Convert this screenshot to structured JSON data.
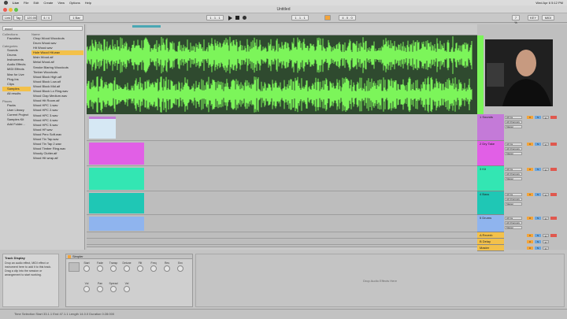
{
  "menubar": {
    "app": "Live",
    "items": [
      "File",
      "Edit",
      "Create",
      "View",
      "Options",
      "Help"
    ],
    "clock": "Wed Apr 6  5:12 PM"
  },
  "window": {
    "title": "Untitled"
  },
  "transport": {
    "link": "Link",
    "tap": "Tap",
    "tempo": "120.00",
    "sig": "4 / 4",
    "quant": "1 Bar",
    "pos": "1 . 1 . 1",
    "loop_start": "1 . 1 . 1",
    "loop_len": "4 . 0 . 0",
    "cpu": "7 %",
    "key": "KEY",
    "midi": "MIDI"
  },
  "browser": {
    "search": "wood",
    "collections_header": "Collections",
    "favorites": "Favorites",
    "categories_header": "Categories",
    "categories": [
      "Sounds",
      "Drums",
      "Instruments",
      "Audio Effects",
      "MIDI Effects",
      "Max for Live",
      "Plug-Ins",
      "Clips",
      "Samples",
      "All results"
    ],
    "places_header": "Places",
    "places": [
      "Packs",
      "User Library",
      "Current Project",
      "Samples Kit",
      "Add Folder..."
    ],
    "results_header": "Name",
    "results": [
      "Chop Wood Woodcuts",
      "Drum Wood.wav",
      "Hit Wood.wav",
      "Hole Wood Hit.wav",
      "Main Wood.aif",
      "Metal Wood.aif",
      "Smoke Blaring Woodcuts",
      "Timber Woodcuts",
      "Wood Block High.aif",
      "Wood Block Low.aif",
      "Wood Block Mid.aif",
      "Wood Block Lo Ring.wav",
      "Wood Clap Medium.wav",
      "Wood Hit Room.aif",
      "Wood HPC 1.wav",
      "Wood HPC 2.wav",
      "Wood HPC 3.wav",
      "Wood HPC 4.wav",
      "Wood HPC 5.wav",
      "Wood HF.wav",
      "Wood Perc Soft.wav",
      "Wood Tin Tap.wav",
      "Wood Tin Tap 2.wav",
      "Wood Timber Ring.wav",
      "Woody Clutter.aif",
      "Wood Hit wrap.aif"
    ]
  },
  "tracks": [
    {
      "name": "1 Sounds",
      "color": "#c47ad8"
    },
    {
      "name": "2 Dry Take",
      "color": "#e15fe6"
    },
    {
      "name": "3 Kit",
      "color": "#33e6b3"
    },
    {
      "name": "4 Bass",
      "color": "#1fc7b5"
    },
    {
      "name": "5 Drums",
      "color": "#8fb4ee"
    }
  ],
  "returns": [
    {
      "name": "A Reverb"
    },
    {
      "name": "B Delay"
    }
  ],
  "master": {
    "name": "Master"
  },
  "mixer_labels": {
    "in": "All Ins",
    "ch": "All Channels",
    "mon": "In Auto Off",
    "out": "Master",
    "vol": "0",
    "pan": "C",
    "arm": "S",
    "solo": "S"
  },
  "info": {
    "title": "Track Display",
    "body": "Drop an audio effect, MIDI effect or instrument here to add it to this track. Drag a clip into the session or arrangement to start working."
  },
  "device": {
    "name": "Simpler",
    "labels": [
      "Start",
      "Fade",
      "Transp",
      "Detune",
      "Filt",
      "Freq",
      "Res",
      "Env",
      "Vol",
      "Pan",
      "Spread",
      "Vel"
    ]
  },
  "dropzone": {
    "text": "Drop Audio Effects Here"
  },
  "status": {
    "text": "Time Selection   Start 33.1.1   End 47.1.1   Length 14.0.0   Duration 0:28:000"
  },
  "colors": {
    "wave": "#7cf55a",
    "wave_bg": "#2f4a2f",
    "accent": "#f3a43a"
  },
  "icons": [
    "apple-icon",
    "play-icon",
    "stop-icon",
    "record-icon",
    "search-icon",
    "folder-icon"
  ]
}
